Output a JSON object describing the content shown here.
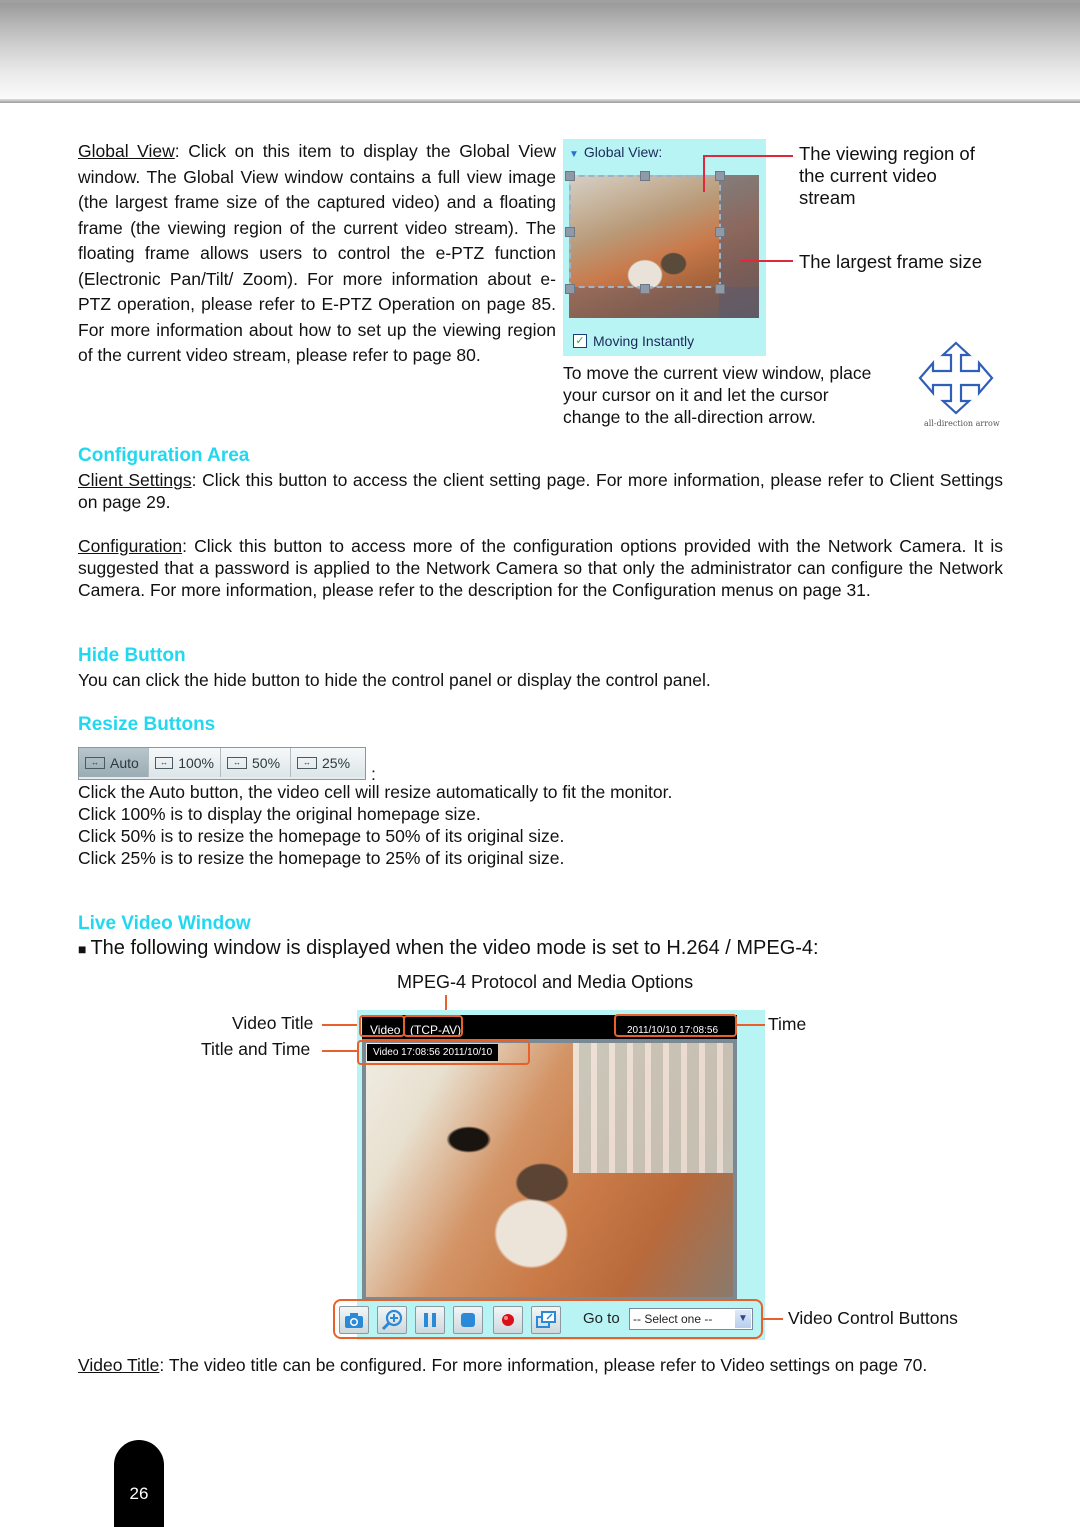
{
  "global_view": {
    "link": "Global View",
    "paragraph_lines": [
      ": Click on this item to display the Global",
      "View window. The Global View window contains a full",
      "view image (the largest frame size of the captured",
      "video) and a floating frame (the viewing region of the",
      "current video stream). The floating frame allows users",
      "to control the e-PTZ function (Electronic Pan/Tilt/",
      "Zoom). For more information about e-PTZ operation,",
      "please refer to E-PTZ Operation on page 85. For more",
      "information about how to set up the viewing region of",
      "the current video stream, please refer to page 80."
    ],
    "panel": {
      "title": "Global View:",
      "checkbox_label": "Moving Instantly",
      "checkbox_checked": true
    },
    "callouts": {
      "viewing_region_lines": [
        "The viewing region of",
        "the current video",
        "stream"
      ],
      "largest_frame": "The largest frame size"
    },
    "move_instruction_lines": [
      "To move the current view window, place",
      "your cursor on it and let the cursor",
      "change to the all-direction arrow."
    ],
    "arrow_caption": "all-direction arrow"
  },
  "configuration_area": {
    "heading": "Configuration Area",
    "client_settings": {
      "link": "Client Settings",
      "text": ": Click this button to access the client setting page. For more information, please refer to Client Settings on page 29."
    },
    "configuration": {
      "link": "Configuration",
      "text": ": Click this button to access more of the configuration options provided with the Network Camera. It is suggested that a password is applied to the Network Camera so that only the administrator can configure the Network Camera. For more information, please refer to the description for the Configuration menus on page 31."
    }
  },
  "hide_button": {
    "heading": "Hide Button",
    "text": "You can click the hide button to hide the control panel or display the control panel."
  },
  "resize_buttons": {
    "heading": "Resize Buttons",
    "buttons": [
      {
        "label": "Auto",
        "active": true
      },
      {
        "label": "100%",
        "active": false
      },
      {
        "label": "50%",
        "active": false
      },
      {
        "label": "25%",
        "active": false
      }
    ],
    "colon": ":",
    "lines": [
      "Click the Auto button, the video cell will resize automatically to fit the monitor.",
      "Click 100% is to display the original homepage size.",
      "Click 50% is to resize the homepage to 50% of its original size.",
      "Click 25% is to resize the homepage to 25% of its original size."
    ]
  },
  "live_video_window": {
    "heading": "Live Video Window",
    "bullet": "■",
    "intro": "The following window is displayed when the video mode is set to H.264 / MPEG-4:",
    "protocol_label": "MPEG-4 Protocol and Media Options",
    "labels": {
      "video_title": "Video Title",
      "title_and_time": "Title and Time",
      "time": "Time",
      "video_control_buttons": "Video Control Buttons"
    },
    "screen": {
      "title": "Video",
      "protocol": "(TCP-AV)",
      "timestamp": "2011/10/10 17:08:56",
      "overlay": "Video 17:08:56  2011/10/10"
    },
    "controls": {
      "buttons": [
        "snapshot-icon",
        "digital-zoom-icon",
        "pause-icon",
        "stop-icon",
        "record-icon",
        "view-size-icon"
      ],
      "goto_label": "Go to",
      "select_value": "-- Select one --"
    },
    "footnote": {
      "link": "Video Title",
      "text": ": The video title can be configured. For more information, please refer to Video settings on page 70."
    }
  },
  "page_number": "26",
  "colors": {
    "heading": "#22d8f0",
    "callout_line": "#e0283c",
    "annotation_orange": "#e8602a",
    "panel_bg": "#b8f4f4"
  }
}
